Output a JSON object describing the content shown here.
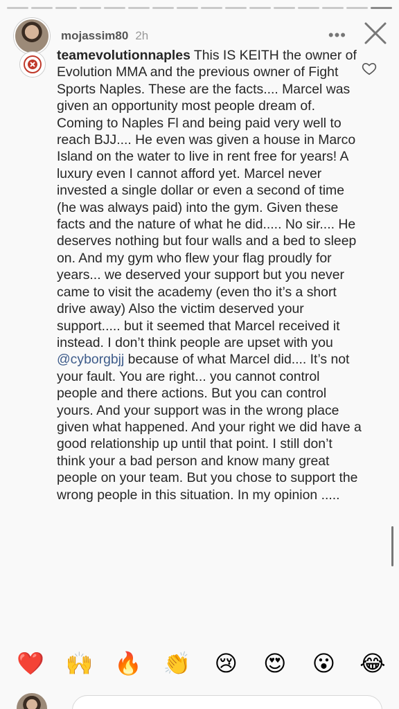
{
  "story": {
    "progress_segments": 16,
    "active_segment": 16
  },
  "header": {
    "username": "mojassim80",
    "time": "2h",
    "more_label": "•••",
    "close_icon": "close-icon"
  },
  "comment": {
    "username": "teamevolutionnaples",
    "text_part1": " This IS KEITH the owner of Evolution MMA and the previous owner of Fight Sports Naples. These are the facts.... Marcel was given an opportunity most people dream of. Coming to Naples Fl and being paid very well to reach BJJ.... He even was given a house in Marco Island on the water to live in rent free for years! A luxury even I cannot afford yet. Marcel never invested a single dollar or even a second of time (he was always paid) into the gym. Given these facts and the nature of what he did..... No sir.... He deserves nothing but four walls and a bed to sleep on. And my gym who flew your flag proudly for years... we deserved your support but you never came to visit the academy (even tho it’s a short drive away) Also the victim deserved your support..... but it seemed that Marcel received it instead. I don’t think people are upset with you ",
    "mention": "@cyborgbjj",
    "text_part2": " because of what Marcel did.... It’s not your fault. You are right... you cannot control people and there actions. But you can control yours. And your support was in the wrong place given what happened. And your right we did have a good relationship up until that point. I still don’t think your a bad person and know many great people on your team. But you chose to support the wrong people in this situation. In my opinion .....",
    "like_icon": "heart-outline-icon"
  },
  "reactions": [
    "❤️",
    "🙌",
    "🔥",
    "👏",
    "😢",
    "😍",
    "😮",
    "😂"
  ],
  "colors": {
    "background": "#f9f9f9",
    "text": "#262626",
    "mention": "#3d5b8a",
    "meta": "#999999"
  }
}
